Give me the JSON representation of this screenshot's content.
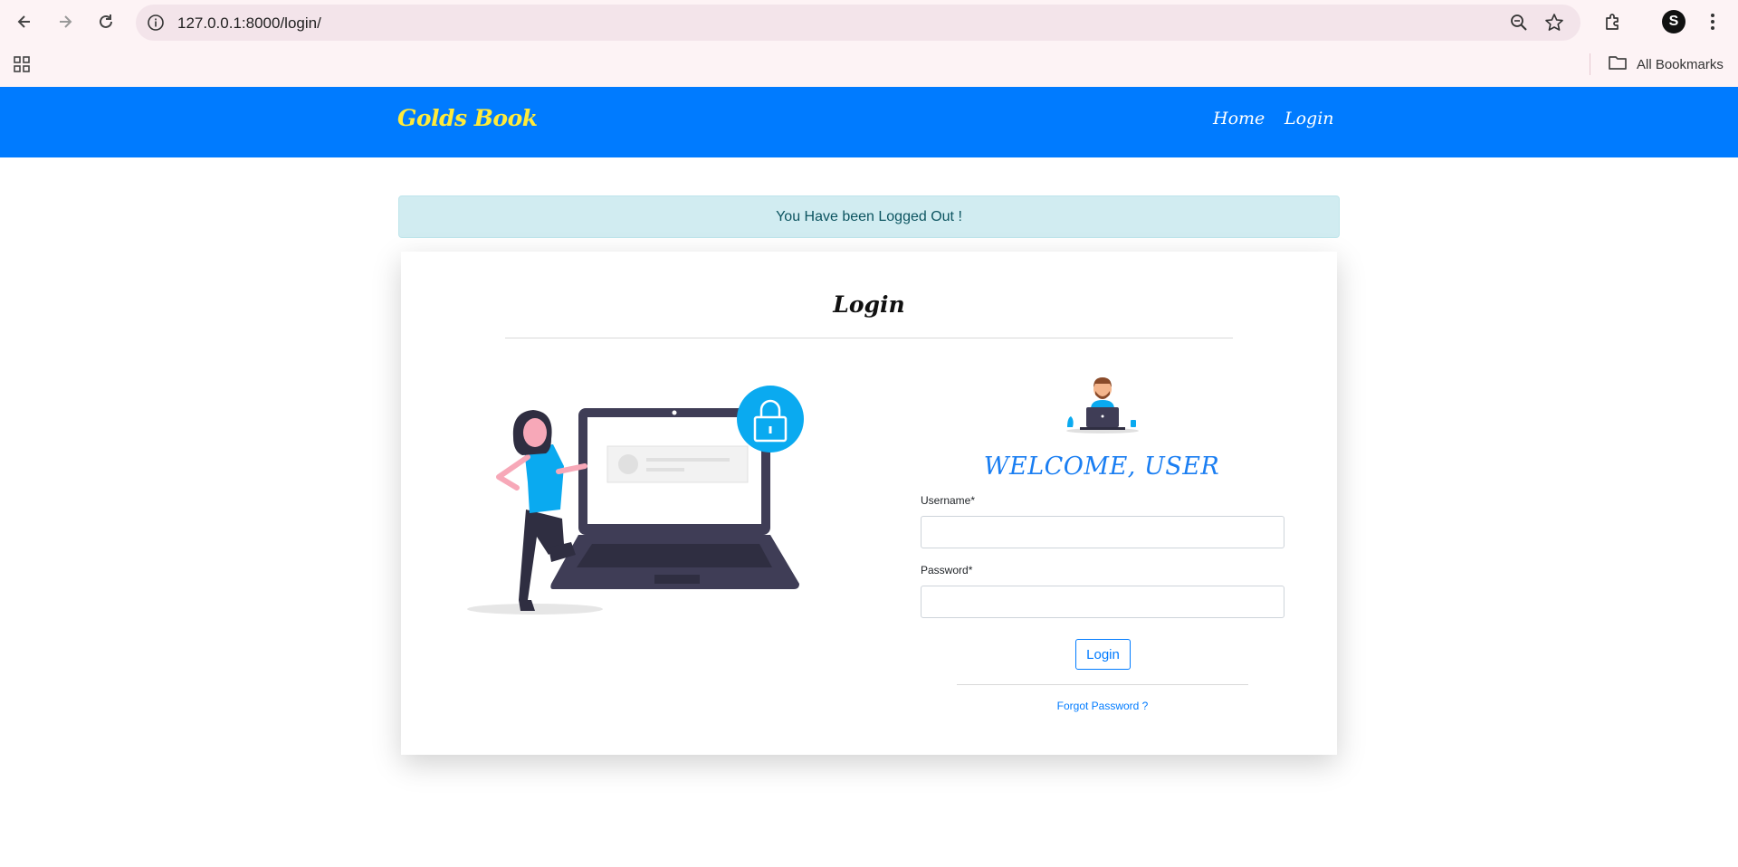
{
  "browser": {
    "url": "127.0.0.1:8000/login/",
    "bookmarks_label": "All Bookmarks",
    "profile_initial": "S"
  },
  "navbar": {
    "brand": "Golds Book",
    "links": [
      "Home",
      "Login"
    ],
    "bg_color": "#007bff",
    "brand_color": "#ffeb3b"
  },
  "alert": {
    "message": "You Have been Logged Out !"
  },
  "card": {
    "title": "Login",
    "welcome": "WELCOME, USER",
    "username_label": "Username*",
    "password_label": "Password*",
    "username_value": "",
    "password_value": "",
    "login_button": "Login",
    "forgot_link": "Forgot Password ?"
  },
  "icons": [
    "back-icon",
    "forward-icon",
    "reload-icon",
    "info-icon",
    "zoom-icon",
    "star-icon",
    "extensions-icon",
    "menu-icon",
    "apps-icon",
    "folder-icon",
    "lock-icon"
  ]
}
